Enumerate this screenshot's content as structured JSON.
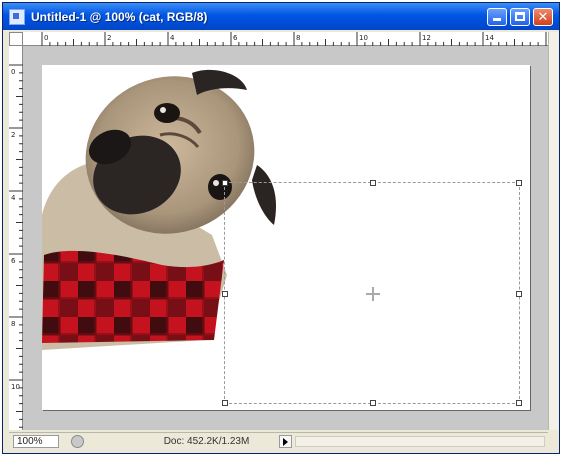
{
  "window": {
    "title": "Untitled-1 @ 100% (cat, RGB/8)"
  },
  "ruler_top": {
    "labels": [
      "0",
      "2",
      "4",
      "6",
      "8",
      "10",
      "12",
      "14"
    ]
  },
  "ruler_left": {
    "labels": [
      "0",
      "2",
      "4",
      "6",
      "8",
      "10"
    ]
  },
  "status": {
    "zoom": "100%",
    "doc_info": "Doc: 452.2K/1.23M"
  },
  "icons": [
    "photoshop-doc-icon",
    "minimize-icon",
    "maximize-icon",
    "close-icon",
    "navigator-icon",
    "status-menu-arrow-icon"
  ],
  "colors": {
    "titlebar": "#0055e5",
    "close_button": "#d0401c",
    "canvas_background": "#c8c8c8"
  }
}
